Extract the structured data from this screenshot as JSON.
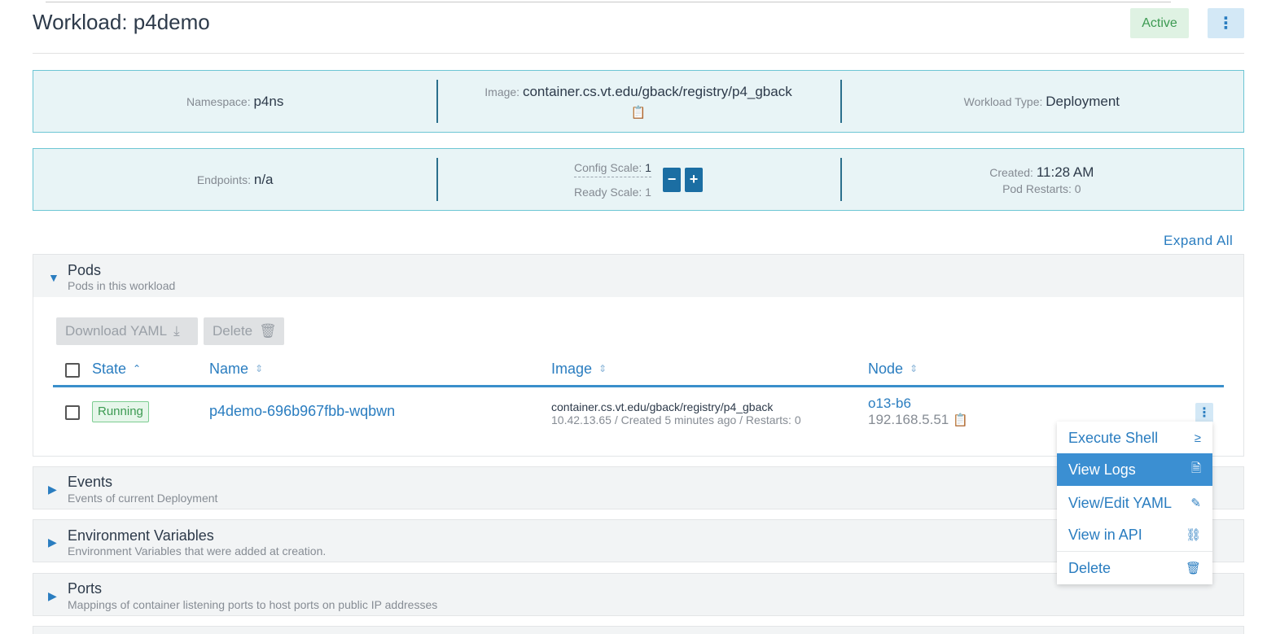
{
  "header": {
    "title": "Workload: p4demo",
    "status": "Active",
    "menu_glyph": "⋮"
  },
  "info_row1": {
    "namespace_label": "Namespace:",
    "namespace_value": "p4ns",
    "image_label": "Image:",
    "image_value": "container.cs.vt.edu/gback/registry/p4_gback",
    "type_label": "Workload Type:",
    "type_value": "Deployment"
  },
  "info_row2": {
    "endpoints_label": "Endpoints:",
    "endpoints_value": "n/a",
    "config_scale_label": "Config Scale:",
    "config_scale_value": "1",
    "ready_scale_label": "Ready Scale:",
    "ready_scale_value": "1",
    "minus": "−",
    "plus": "+",
    "created_label": "Created:",
    "created_value": "11:28 AM",
    "restarts_label": "Pod Restarts:",
    "restarts_value": "0"
  },
  "expand_all": "Expand All",
  "pods": {
    "title": "Pods",
    "subtitle": "Pods in this workload",
    "download_label": "Download YAML",
    "delete_label": "Delete",
    "columns": {
      "state": "State",
      "name": "Name",
      "image": "Image",
      "node": "Node"
    },
    "row": {
      "state": "Running",
      "name": "p4demo-696b967fbb-wqbwn",
      "image": "container.cs.vt.edu/gback/registry/p4_gback",
      "meta": "10.42.13.65 / Created 5 minutes ago / Restarts: 0",
      "node": "o13-b6",
      "node_ip": "192.168.5.51"
    }
  },
  "context_menu": {
    "items": [
      {
        "label": "Execute Shell",
        "icon": "≥"
      },
      {
        "label": "View Logs",
        "icon": "🗎"
      },
      {
        "label": "View/Edit YAML",
        "icon": "✎"
      },
      {
        "label": "View in API",
        "icon": "⛓"
      },
      {
        "label": "Delete",
        "icon": "🗑"
      }
    ]
  },
  "sections": [
    {
      "title": "Events",
      "subtitle": "Events of current Deployment"
    },
    {
      "title": "Environment Variables",
      "subtitle": "Environment Variables that were added at creation."
    },
    {
      "title": "Ports",
      "subtitle": "Mappings of container listening ports to host ports on public IP addresses"
    }
  ]
}
